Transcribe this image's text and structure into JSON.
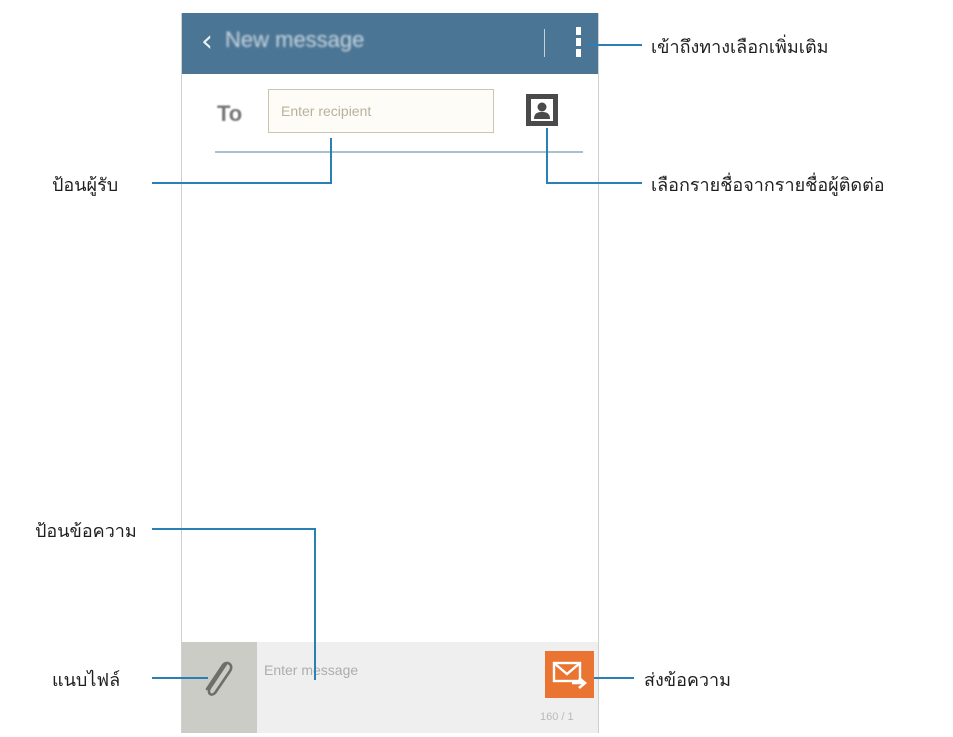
{
  "app": {
    "title": "New message",
    "back_icon": "chevron-left-icon",
    "more_icon": "more-vertical-icon"
  },
  "recipient": {
    "label": "To",
    "placeholder": "Enter recipient",
    "contacts_icon": "contact-person-icon"
  },
  "composer": {
    "attach_icon": "paperclip-icon",
    "placeholder": "Enter message",
    "send_icon": "send-envelope-icon",
    "counter": "160 / 1"
  },
  "callouts": {
    "more_options": "เข้าถึงทางเลือกเพิ่มเติม",
    "enter_recipient": "ป้อนผู้รับ",
    "select_contacts": "เลือกรายชื่อจากรายชื่อผู้ติดต่อ",
    "enter_message": "ป้อนข้อความ",
    "attach_file": "แนบไฟล์",
    "send_message": "ส่งข้อความ"
  },
  "colors": {
    "app_bar": "#4b7594",
    "send_button": "#ea7431",
    "callout_line": "#2a80b4"
  }
}
